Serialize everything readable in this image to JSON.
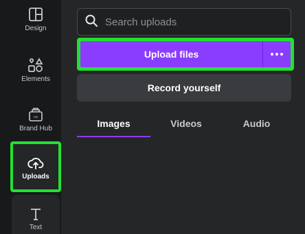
{
  "sidebar": {
    "items": [
      {
        "label": "Design",
        "icon": "layout-icon"
      },
      {
        "label": "Elements",
        "icon": "shapes-icon"
      },
      {
        "label": "Brand Hub",
        "icon": "brand-hub-icon"
      },
      {
        "label": "Uploads",
        "icon": "cloud-upload-icon",
        "active": true
      },
      {
        "label": "Text",
        "icon": "text-icon"
      }
    ]
  },
  "search": {
    "placeholder": "Search uploads",
    "value": ""
  },
  "upload": {
    "label": "Upload files",
    "more_icon": "more-horizontal-icon"
  },
  "record": {
    "label": "Record yourself"
  },
  "tabs": [
    {
      "label": "Images",
      "active": true
    },
    {
      "label": "Videos"
    },
    {
      "label": "Audio"
    }
  ],
  "colors": {
    "accent": "#8b3dff",
    "highlight": "#22e033",
    "sidebar_bg": "#18191b",
    "panel_bg": "#252627"
  }
}
